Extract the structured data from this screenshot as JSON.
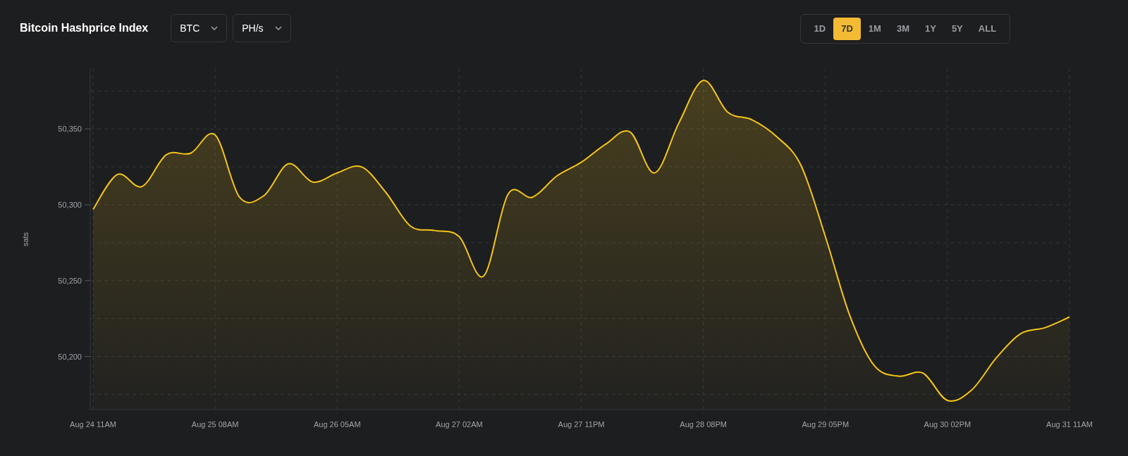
{
  "title": "Bitcoin Hashprice Index",
  "dropdowns": [
    {
      "label": "BTC"
    },
    {
      "label": "PH/s"
    }
  ],
  "ranges": [
    {
      "label": "1D",
      "selected": false
    },
    {
      "label": "7D",
      "selected": true
    },
    {
      "label": "1M",
      "selected": false
    },
    {
      "label": "3M",
      "selected": false
    },
    {
      "label": "1Y",
      "selected": false
    },
    {
      "label": "5Y",
      "selected": false
    },
    {
      "label": "ALL",
      "selected": false
    }
  ],
  "chart_data": {
    "type": "area",
    "ylabel": "sats",
    "categories": [
      "Aug 24 11AM",
      null,
      null,
      null,
      null,
      "Aug 25 08AM",
      null,
      null,
      null,
      null,
      "Aug 26 05AM",
      null,
      null,
      null,
      null,
      "Aug 27 02AM",
      null,
      null,
      null,
      null,
      "Aug 27 11PM",
      null,
      null,
      null,
      null,
      "Aug 28 08PM",
      null,
      null,
      null,
      null,
      "Aug 29 05PM",
      null,
      null,
      null,
      null,
      "Aug 30 02PM",
      null,
      null,
      null,
      null,
      "Aug 31 11AM"
    ],
    "series": [
      {
        "color": "#f5c518",
        "values": [
          50297,
          50320,
          50312,
          50333,
          50334,
          50346,
          50305,
          50306,
          50327,
          50315,
          50321,
          50325,
          50308,
          50286,
          50283,
          50279,
          50253,
          50307,
          50305,
          50319,
          50328,
          50340,
          50348,
          50321,
          50354,
          50382,
          50361,
          50356,
          50345,
          50326,
          50279,
          50227,
          50194,
          50187,
          50189,
          50171,
          50178,
          50199,
          50215,
          50219,
          50226
        ]
      }
    ],
    "ylim": [
      50165,
      50390
    ],
    "grid": true,
    "yticks": [
      {
        "value": 50200,
        "label": "50,200"
      },
      {
        "value": 50250,
        "label": "50,250"
      },
      {
        "value": 50300,
        "label": "50,300"
      },
      {
        "value": 50350,
        "label": "50,350"
      }
    ]
  }
}
